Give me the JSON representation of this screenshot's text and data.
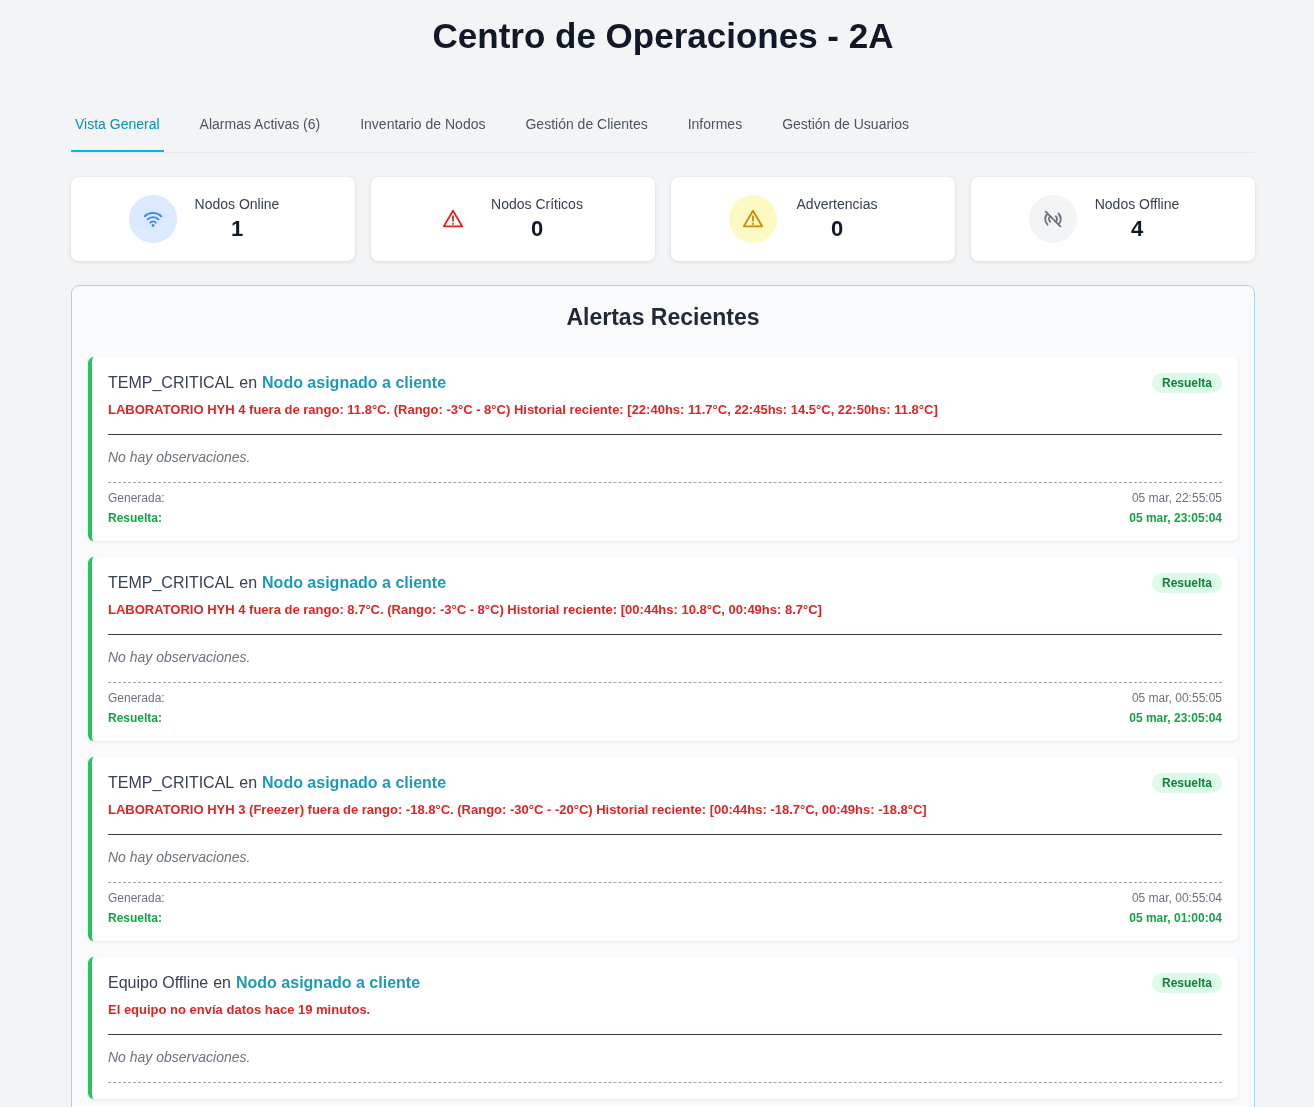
{
  "title": "Centro de Operaciones - 2A",
  "tabs": [
    {
      "label": "Vista General",
      "selected": true
    },
    {
      "label": "Alarmas Activas (6)",
      "selected": false
    },
    {
      "label": "Inventario de Nodos",
      "selected": false
    },
    {
      "label": "Gestión de Clientes",
      "selected": false
    },
    {
      "label": "Informes",
      "selected": false
    },
    {
      "label": "Gestión de Usuarios",
      "selected": false
    }
  ],
  "stats": [
    {
      "kind": "online",
      "label": "Nodos Online",
      "value": "1"
    },
    {
      "kind": "critical",
      "label": "Nodos Críticos",
      "value": "0"
    },
    {
      "kind": "warning",
      "label": "Advertencias",
      "value": "0"
    },
    {
      "kind": "offline",
      "label": "Nodos Offline",
      "value": "4"
    }
  ],
  "alerts_panel": {
    "title": "Alertas Recientes",
    "alerts": [
      {
        "type": "TEMP_CRITICAL",
        "connector": "en",
        "node": "Nodo asignado a cliente",
        "status": "Resuelta",
        "message": "LABORATORIO HYH 4 fuera de rango: 11.8°C. (Rango: -3°C - 8°C) Historial reciente: [22:40hs: 11.7°C, 22:45hs: 14.5°C, 22:50hs: 11.8°C]",
        "observations": "No hay observaciones.",
        "generated_label": "Generada:",
        "generated": "05 mar, 22:55:05",
        "resolved_label": "Resuelta:",
        "resolved": "05 mar, 23:05:04"
      },
      {
        "type": "TEMP_CRITICAL",
        "connector": "en",
        "node": "Nodo asignado a cliente",
        "status": "Resuelta",
        "message": "LABORATORIO HYH 4 fuera de rango: 8.7°C. (Rango: -3°C - 8°C) Historial reciente: [00:44hs: 10.8°C, 00:49hs: 8.7°C]",
        "observations": "No hay observaciones.",
        "generated_label": "Generada:",
        "generated": "05 mar, 00:55:05",
        "resolved_label": "Resuelta:",
        "resolved": "05 mar, 23:05:04"
      },
      {
        "type": "TEMP_CRITICAL",
        "connector": "en",
        "node": "Nodo asignado a cliente",
        "status": "Resuelta",
        "message": "LABORATORIO HYH 3 (Freezer) fuera de rango: -18.8°C. (Rango: -30°C - -20°C) Historial reciente: [00:44hs: -18.7°C, 00:49hs: -18.8°C]",
        "observations": "No hay observaciones.",
        "generated_label": "Generada:",
        "generated": "05 mar, 00:55:04",
        "resolved_label": "Resuelta:",
        "resolved": "05 mar, 01:00:04"
      },
      {
        "type": "Equipo Offline",
        "connector": "en",
        "node": "Nodo asignado a cliente",
        "status": "Resuelta",
        "message": "El equipo no envía datos hace 19 minutos.",
        "observations": "No hay observaciones."
      }
    ]
  }
}
